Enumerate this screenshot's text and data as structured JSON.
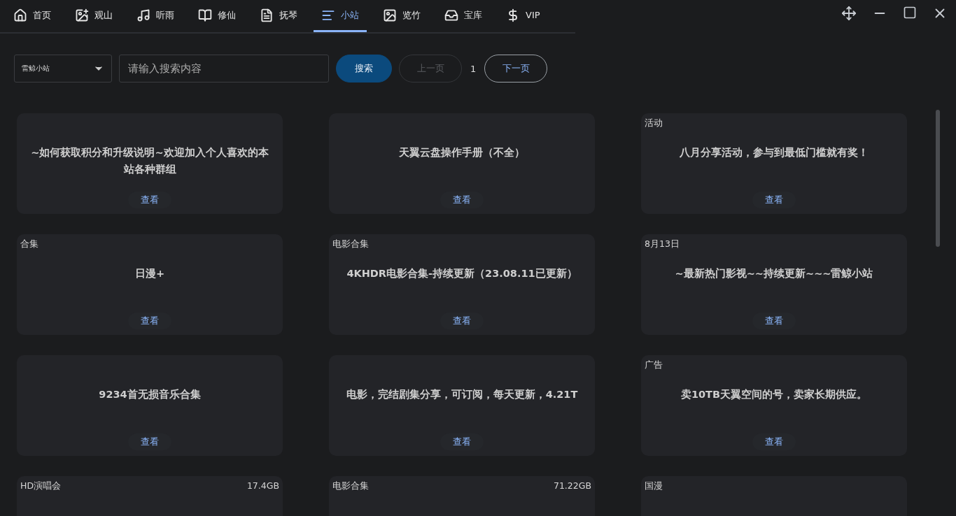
{
  "tabs": [
    {
      "label": "首页",
      "selected": false
    },
    {
      "label": "观山",
      "selected": false
    },
    {
      "label": "听雨",
      "selected": false
    },
    {
      "label": "修仙",
      "selected": false
    },
    {
      "label": "抚琴",
      "selected": false
    },
    {
      "label": "小站",
      "selected": true
    },
    {
      "label": "览竹",
      "selected": false
    },
    {
      "label": "宝库",
      "selected": false
    },
    {
      "label": "VIP",
      "selected": false
    }
  ],
  "toolbar": {
    "source": "雷鲸小站",
    "search": {
      "placeholder": "请输入搜索内容"
    },
    "search_button": "搜索",
    "prev_button": {
      "label": "上一页",
      "disabled": true
    },
    "page": "1",
    "next_button": {
      "label": "下一页",
      "disabled": false
    }
  },
  "cards": [
    {
      "title": "~如何获取积分和升级说明~欢迎加入个人喜欢的本站各种群组",
      "action": "查看"
    },
    {
      "title": "天翼云盘操作手册（不全）",
      "action": "查看"
    },
    {
      "tag": "活动",
      "title": "八月分享活动，参与到最低门槛就有奖！",
      "action": "查看"
    },
    {
      "tag": "合集",
      "title": "日漫+",
      "action": "查看"
    },
    {
      "tag": "电影合集",
      "title": "4KHDR电影合集-持续更新（23.08.11已更新）",
      "action": "查看"
    },
    {
      "tag": "8月13日",
      "title": "~最新热门影视~~持续更新~~~雷鲸小站",
      "action": "查看"
    },
    {
      "title": "9234首无损音乐合集",
      "action": "查看"
    },
    {
      "title": "电影，完结剧集分享，可订阅，每天更新，4.21T",
      "action": "查看"
    },
    {
      "tag": "广告",
      "title": "卖10TB天翼空间的号，卖家长期供应。",
      "action": "查看"
    },
    {
      "tag": "HD演唱会",
      "size": "17.4GB"
    },
    {
      "tag": "电影合集",
      "size": "71.22GB"
    },
    {
      "tag": "国漫"
    }
  ]
}
